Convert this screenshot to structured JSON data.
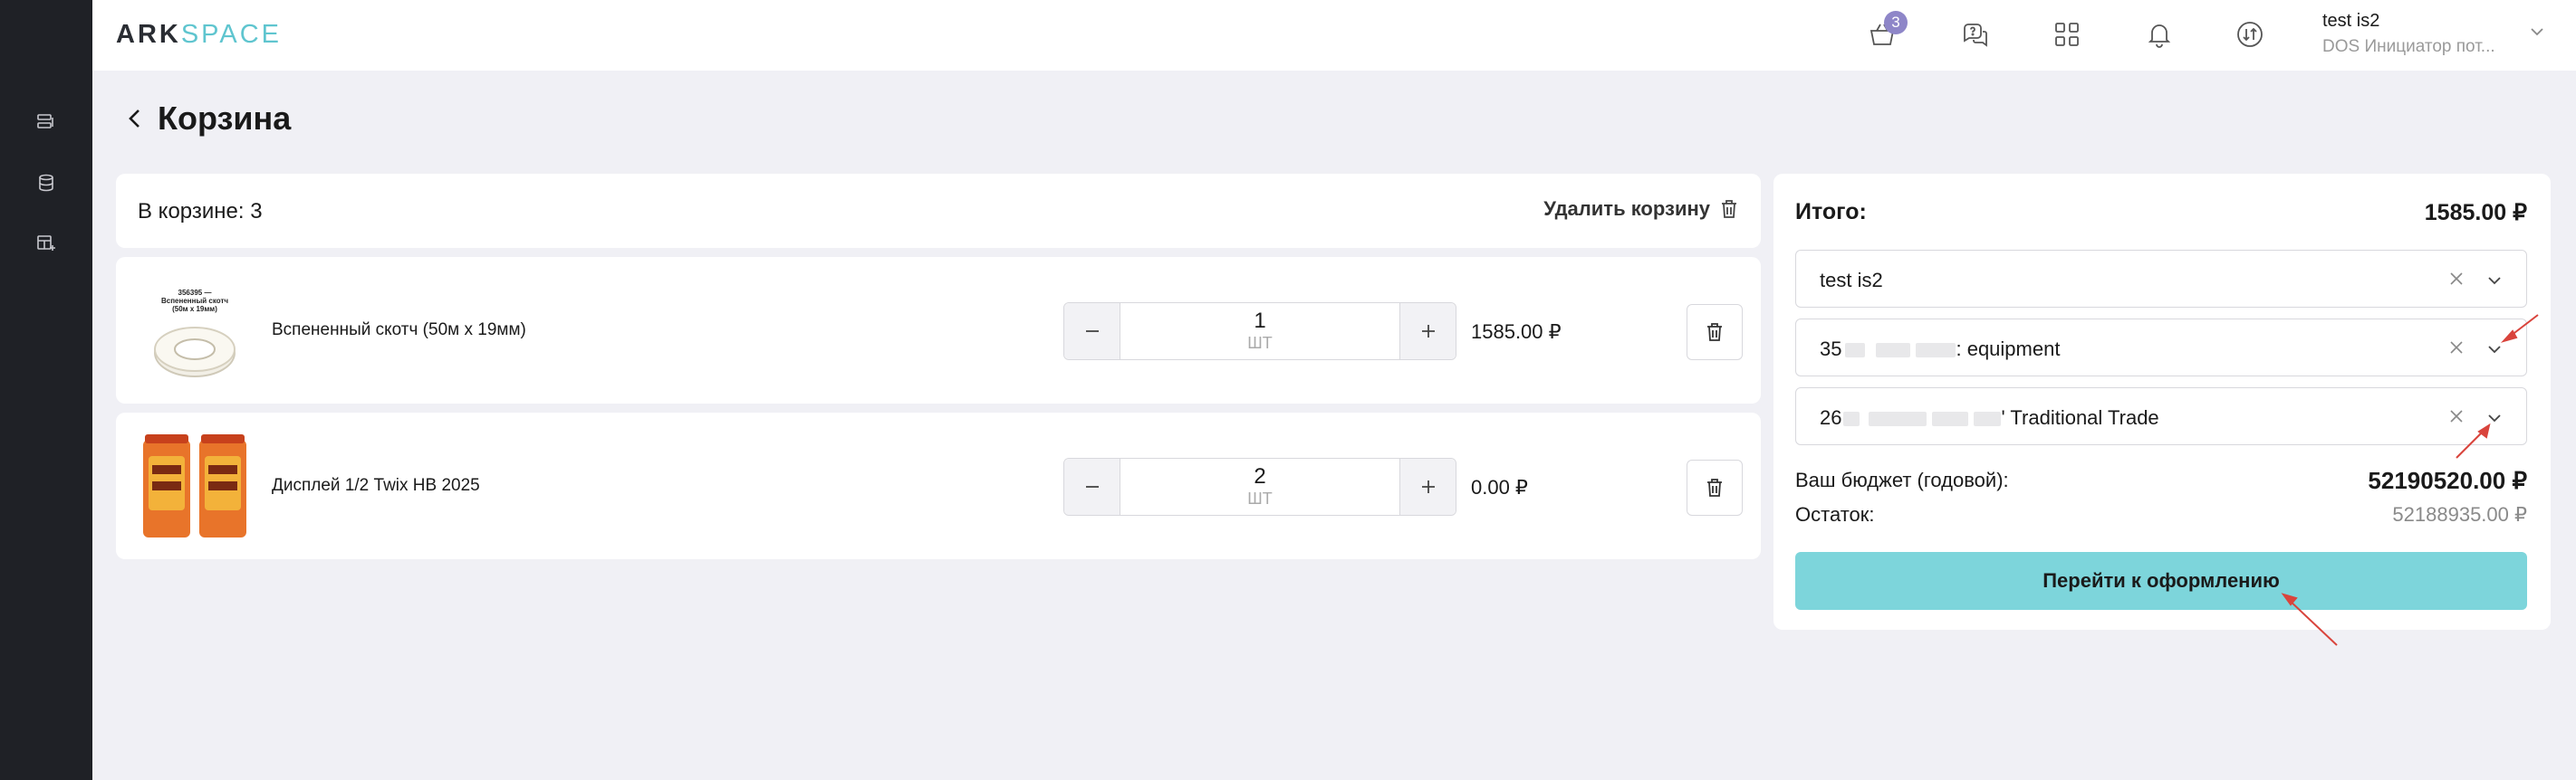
{
  "brand": {
    "part1": "ARK",
    "part2": "SPACE"
  },
  "sidebar": {
    "items": [
      {
        "icon": "list-icon"
      },
      {
        "icon": "database-icon"
      },
      {
        "icon": "table-add-icon"
      }
    ]
  },
  "header": {
    "cart_badge": "3",
    "user_name": "test is2",
    "user_role": "DOS Инициатор пот..."
  },
  "page": {
    "title": "Корзина"
  },
  "cart": {
    "count_label": "В корзине: 3",
    "clear_label": "Удалить корзину",
    "items": [
      {
        "name": "Вспененный скотч (50м х 19мм)",
        "qty": "1",
        "unit": "ШТ",
        "price": "1585.00 ₽",
        "image_text": "356395 — Вспененный скотч (50м х 19мм)"
      },
      {
        "name": "Дисплей 1/2 Twix HB 2025",
        "qty": "2",
        "unit": "ШТ",
        "price": "0.00 ₽"
      }
    ]
  },
  "summary": {
    "title": "Итого:",
    "total": "1585.00 ₽",
    "select1": "test is2",
    "select2_prefix": "35",
    "select2_suffix": ": equipment",
    "select3_prefix": "26",
    "select3_suffix": "' Traditional Trade",
    "budget_label": "Ваш бюджет (годовой):",
    "budget_value": "52190520.00 ₽",
    "rest_label": "Остаток:",
    "rest_value": "52188935.00 ₽",
    "checkout_label": "Перейти к оформлению"
  },
  "colors": {
    "accent": "#7dd5db",
    "badge": "#8e86c8",
    "sidebar": "#1f2126",
    "arrow": "#d9443c"
  }
}
